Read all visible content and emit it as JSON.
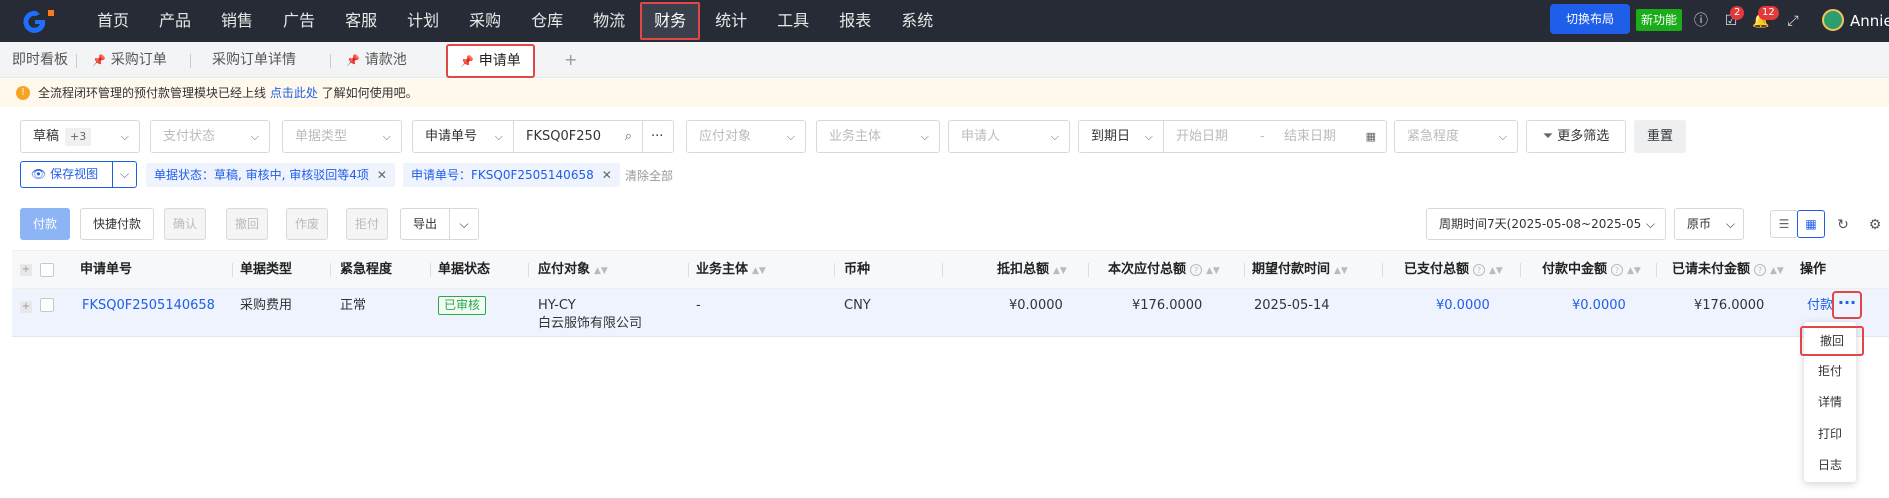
{
  "topnav": {
    "menu": [
      "首页",
      "产品",
      "销售",
      "广告",
      "客服",
      "计划",
      "采购",
      "仓库",
      "物流",
      "财务",
      "统计",
      "工具",
      "报表",
      "系统"
    ],
    "active": "财务",
    "switch_layout": "切换布局",
    "new_feature": "新功能",
    "badge_tasks": "2",
    "badge_notices": "12",
    "user": "Annie"
  },
  "tabs": {
    "items": [
      "即时看板",
      "采购订单",
      "采购订单详情",
      "请款池",
      "申请单"
    ],
    "add": "+"
  },
  "notice": {
    "text_before": "全流程闭环管理的预付款管理模块已经上线 ",
    "link": "点击此处",
    "text_after": " 了解如何使用吧。"
  },
  "filters": {
    "status": "草稿",
    "status_more": "+3",
    "pay_status": "支付状态",
    "doc_type": "单据类型",
    "apply_no_label": "申请单号",
    "apply_no_value": "FKSQ0F250",
    "payee": "应付对象",
    "entity": "业务主体",
    "applicant": "申请人",
    "due_label": "到期日",
    "start_date": "开始日期",
    "date_sep": "-",
    "end_date": "结束日期",
    "urgency": "紧急程度",
    "more_filters": "更多筛选",
    "reset": "重置",
    "more_dots": "···"
  },
  "tags": {
    "save_view": "保存视图",
    "tag1": "单据状态：草稿, 审核中, 审核驳回等4项",
    "tag2": "申请单号：FKSQ0F2505140658",
    "clear_all": "清除全部"
  },
  "actions": {
    "pay": "付款",
    "quick_pay": "快捷付款",
    "confirm": "确认",
    "withdraw": "撤回",
    "void": "作废",
    "reject": "拒付",
    "export": "导出",
    "period": "周期时间7天(2025-05-08~2025-05",
    "currency": "原币"
  },
  "table": {
    "headers": [
      "申请单号",
      "单据类型",
      "紧急程度",
      "单据状态",
      "应付对象",
      "业务主体",
      "币种",
      "抵扣总额",
      "本次应付总额",
      "期望付款时间",
      "已支付总额",
      "付款中金额",
      "已请未付金额",
      "操作"
    ],
    "row": {
      "apply_no": "FKSQ0F2505140658",
      "doc_type": "采购费用",
      "urgency": "正常",
      "status": "已审核",
      "payee_line1": "HY-CY",
      "payee_line2": "白云服饰有限公司",
      "entity": "-",
      "currency": "CNY",
      "deduct_total": "¥0.0000",
      "payable_total": "¥176.0000",
      "expected_date": "2025-05-14",
      "paid_total": "¥0.0000",
      "paying_amount": "¥0.0000",
      "unpaid_amount": "¥176.0000",
      "op_pay": "付款",
      "op_more": "···"
    }
  },
  "dropdown": [
    "撤回",
    "拒付",
    "详情",
    "打印",
    "日志"
  ]
}
